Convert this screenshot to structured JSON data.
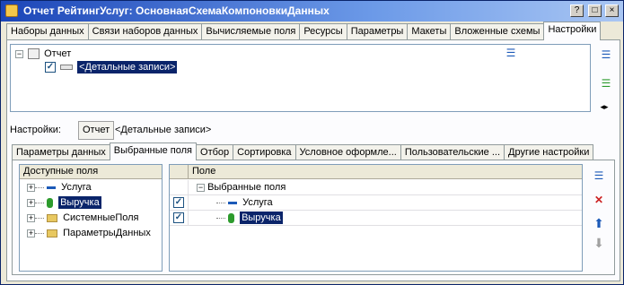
{
  "window": {
    "title": "Отчет РейтингУслуг: ОсновнаяСхемаКомпоновкиДанных",
    "buttons": {
      "help": "?",
      "maximize": "□",
      "close": "×"
    }
  },
  "top_tabs": [
    "Наборы данных",
    "Связи наборов данных",
    "Вычисляемые поля",
    "Ресурсы",
    "Параметры",
    "Макеты",
    "Вложенные схемы",
    "Настройки"
  ],
  "top_tab_active": "Настройки",
  "structure": {
    "root": "Отчет",
    "child": "<Детальные записи>",
    "child_checked": true
  },
  "settings": {
    "label": "Настройки:",
    "button": "Отчет",
    "value": "<Детальные записи>"
  },
  "inner_tabs": [
    "Параметры данных",
    "Выбранные поля",
    "Отбор",
    "Сортировка",
    "Условное оформле...",
    "Пользовательские ...",
    "Другие настройки"
  ],
  "inner_tab_active": "Выбранные поля",
  "available_fields": {
    "header": "Доступные поля",
    "items": [
      {
        "label": "Услуга",
        "icon": "field-icon"
      },
      {
        "label": "Выручка",
        "icon": "resource-icon",
        "selected": true
      },
      {
        "label": "СистемныеПоля",
        "icon": "folder-icon"
      },
      {
        "label": "ПараметрыДанных",
        "icon": "folder-icon"
      }
    ]
  },
  "selected_fields": {
    "header": "Поле",
    "group": "Выбранные поля",
    "rows": [
      {
        "label": "Услуга",
        "checked": true,
        "icon": "field-icon"
      },
      {
        "label": "Выручка",
        "checked": true,
        "icon": "resource-icon",
        "selected": true
      }
    ]
  },
  "colors": {
    "titlebar": "#1c46b8",
    "selection": "#0a246a",
    "panel": "#ece9d8",
    "move_up_arrow": "#1c5ab8"
  }
}
